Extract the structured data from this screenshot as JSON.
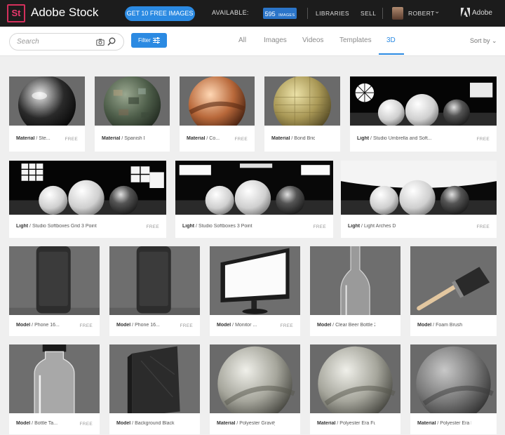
{
  "app": {
    "logo": "St",
    "title": "Adobe Stock"
  },
  "header": {
    "cta_label": "GET 10 FREE IMAGES",
    "available_label": "AVAILABLE:",
    "available_count": "595",
    "available_unit": "IMAGES",
    "libraries_label": "LIBRARIES",
    "sell_label": "SELL",
    "user_name": "ROBERT",
    "adobe_label": "Adobe"
  },
  "search": {
    "placeholder": "Search",
    "filter_label": "Filter"
  },
  "tabs": [
    {
      "label": "All"
    },
    {
      "label": "Images"
    },
    {
      "label": "Videos"
    },
    {
      "label": "Templates"
    },
    {
      "label": "3D",
      "active": true
    }
  ],
  "sort_label": "Sort by",
  "colors": {
    "accent": "#2b8ae2",
    "topbar": "#1c1c1c",
    "logo_pink": "#e8386d"
  },
  "items": [
    {
      "category": "Material",
      "title": " / Ste...",
      "badge": "FREE",
      "kind": "sphere-chrome"
    },
    {
      "category": "Material",
      "title": " / Spanish Di...",
      "badge": "",
      "kind": "sphere-camo"
    },
    {
      "category": "Material",
      "title": " / Co...",
      "badge": "FREE",
      "kind": "sphere-copper"
    },
    {
      "category": "Material",
      "title": " / Bond Brick ...",
      "badge": "",
      "kind": "sphere-brick"
    },
    {
      "category": "Light",
      "title": " / Studio Umbrella and Soft...",
      "badge": "FREE",
      "kind": "light-umbrella"
    },
    {
      "category": "Light",
      "title": " / Studio Softboxes Grid 3 Point",
      "badge": "FREE",
      "kind": "light-grid"
    },
    {
      "category": "Light",
      "title": " / Studio Softboxes 3 Point",
      "badge": "FREE",
      "kind": "light-softbox"
    },
    {
      "category": "Light",
      "title": " / Light Arches D",
      "badge": "FREE",
      "kind": "light-arches"
    },
    {
      "category": "Model",
      "title": " / Phone 16...",
      "badge": "FREE",
      "kind": "model-phone"
    },
    {
      "category": "Model",
      "title": " / Phone 16...",
      "badge": "FREE",
      "kind": "model-phone"
    },
    {
      "category": "Model",
      "title": " / Monitor ...",
      "badge": "FREE",
      "kind": "model-monitor"
    },
    {
      "category": "Model",
      "title": " / Clear Beer Bottle 2",
      "badge": "",
      "kind": "model-bottle"
    },
    {
      "category": "Model",
      "title": " / Foam Brush",
      "badge": "",
      "kind": "model-brush"
    },
    {
      "category": "Model",
      "title": " / Bottle Ta...",
      "badge": "FREE",
      "kind": "model-jar"
    },
    {
      "category": "Model",
      "title": " / Background Black...",
      "badge": "",
      "kind": "model-panel"
    },
    {
      "category": "Material",
      "title": " / Polyester Gravity...",
      "badge": "",
      "kind": "sphere-fabric"
    },
    {
      "category": "Material",
      "title": " / Polyester Era Fut...",
      "badge": "",
      "kind": "sphere-fabric"
    },
    {
      "category": "Material",
      "title": " / Polyester Era For...",
      "badge": "",
      "kind": "sphere-fabric-dark"
    }
  ]
}
